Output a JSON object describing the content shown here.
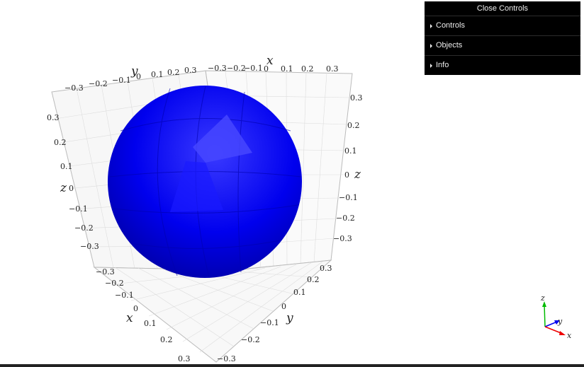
{
  "controls": {
    "close_label": "Close Controls",
    "folders": [
      {
        "label": "Controls"
      },
      {
        "label": "Objects"
      },
      {
        "label": "Info"
      }
    ]
  },
  "axes": {
    "x_title": "x",
    "y_title": "y",
    "z_title": "z",
    "top_x_ticks": [
      "−0.3",
      "−0.2",
      "−0.1",
      "0",
      "0.1",
      "0.2",
      "0.3"
    ],
    "top_y_ticks": [
      "−0.3",
      "−0.2",
      "−0.1",
      "0",
      "0.1",
      "0.2",
      "0.3"
    ],
    "left_z_ticks": [
      "0.3",
      "0.2",
      "0.1",
      "0",
      "−0.1",
      "−0.2",
      "−0.3"
    ],
    "right_z_ticks": [
      "0.3",
      "0.2",
      "0.1",
      "0",
      "−0.1",
      "−0.2",
      "−0.3"
    ],
    "bottom_x_ticks": [
      "−0.3",
      "−0.2",
      "−0.1",
      "0",
      "0.1",
      "0.2",
      "0.3"
    ],
    "bottom_y_ticks": [
      "0.3",
      "0.2",
      "0.1",
      "0",
      "−0.1",
      "−0.2",
      "−0.3"
    ]
  },
  "object": {
    "shape": "sphere",
    "color": "#0000ee"
  },
  "gizmo": {
    "x_label": "x",
    "y_label": "y",
    "z_label": "z",
    "x_color": "#ee0000",
    "y_color": "#0000ee",
    "z_color": "#00bb00"
  }
}
